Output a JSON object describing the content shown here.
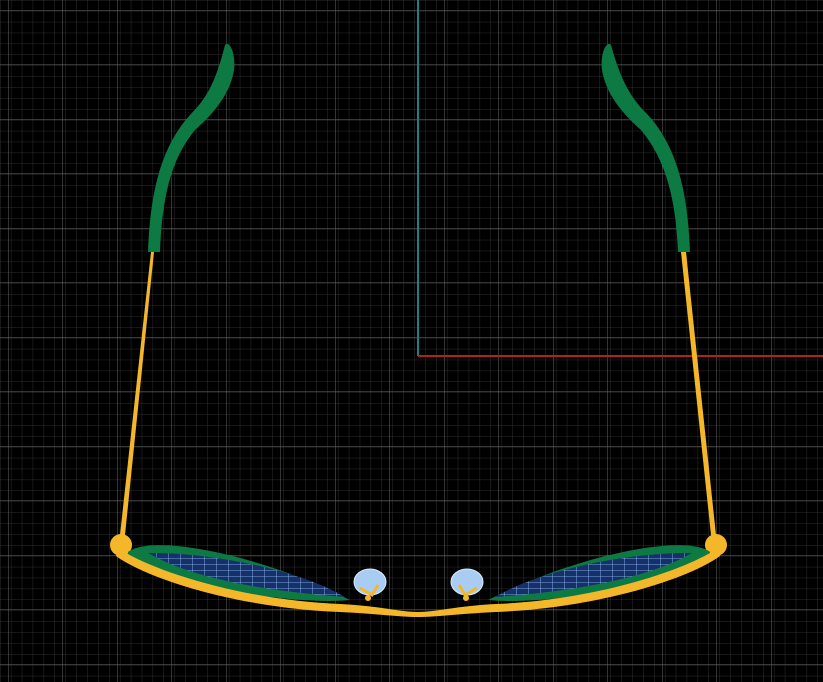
{
  "viewport": {
    "view": "top",
    "background_color": "#000000",
    "grid": {
      "visible": true,
      "minor_color": "#3a3a3a",
      "major_color": "#5a5a5a"
    },
    "axes": {
      "x_axis_color": "#b0221c",
      "y_axis_color": "#1f7f86"
    }
  },
  "model": {
    "name": "eyeglasses",
    "frame_color": "#f5b72a",
    "temple_tip_color": "#0c7a42",
    "rim_color": "#0c7a42",
    "lens_color": "#7fb2ff",
    "nose_pad_color": "#a9cdf2"
  }
}
